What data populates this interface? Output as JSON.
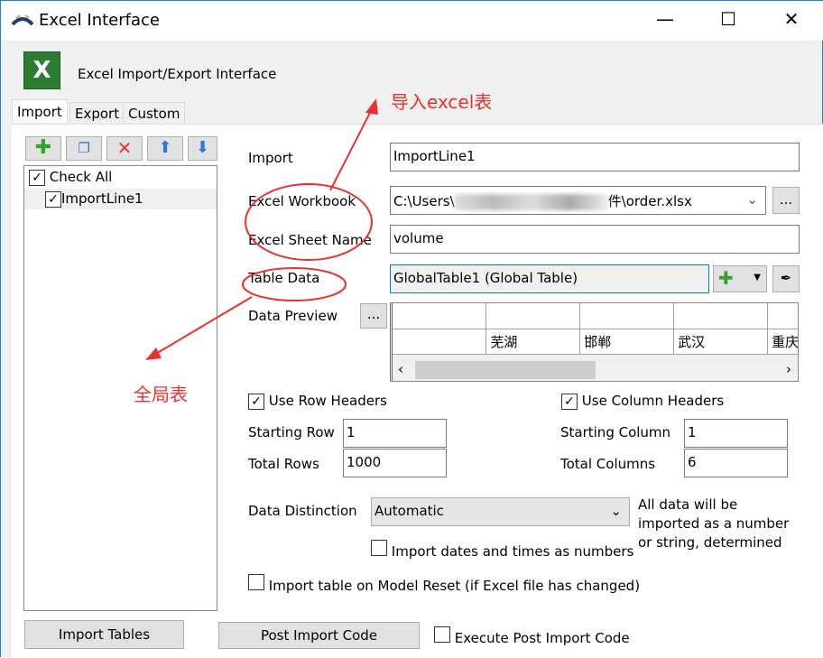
{
  "window": {
    "title": "Excel Interface",
    "icon": "flexsim-logo-icon"
  },
  "header": {
    "title": "Excel Import/Export Interface",
    "icon": "excel-icon"
  },
  "tabs": [
    {
      "label": "Import",
      "active": true
    },
    {
      "label": "Export"
    },
    {
      "label": "Custom"
    }
  ],
  "toolbar": [
    "add-icon",
    "copy-icon",
    "delete-icon",
    "move-up-icon",
    "move-down-icon"
  ],
  "tree": {
    "check_all": "Check All",
    "items": [
      {
        "label": "ImportLine1",
        "checked": true
      }
    ]
  },
  "form": {
    "import_label": "Import",
    "import_value": "ImportLine1",
    "workbook_label": "Excel Workbook",
    "workbook_prefix": "C:\\Users\\",
    "workbook_suffix": "件\\order.xlsx",
    "browse": "...",
    "sheet_label": "Excel Sheet Name",
    "sheet_value": "volume",
    "table_label": "Table Data",
    "table_value": "GlobalTable1 (Global Table)",
    "preview_label": "Data Preview",
    "preview_btn": "...",
    "preview_row": [
      "",
      "芜湖",
      "邯郸",
      "武汉",
      "重庆"
    ],
    "use_row_headers": "Use Row Headers",
    "use_col_headers": "Use Column Headers",
    "start_row_label": "Starting Row",
    "start_row": "1",
    "total_rows_label": "Total Rows",
    "total_rows": "1000",
    "start_col_label": "Starting Column",
    "start_col": "1",
    "total_cols_label": "Total Columns",
    "total_cols": "6",
    "distinction_label": "Data Distinction",
    "distinction_value": "Automatic",
    "distinction_note": "All data will be imported as a number or string, determined",
    "import_dates": "Import dates and times as numbers",
    "import_on_reset": "Import table on Model Reset (if Excel file has changed)"
  },
  "footer": {
    "import_tables": "Import Tables",
    "post_import_code": "Post Import Code",
    "execute_post": "Execute Post Import Code"
  },
  "annotations": {
    "import_excel": "导入excel表",
    "global_table": "全局表"
  },
  "colors": {
    "annotation": "#e8322d",
    "focus": "#0078d7"
  }
}
